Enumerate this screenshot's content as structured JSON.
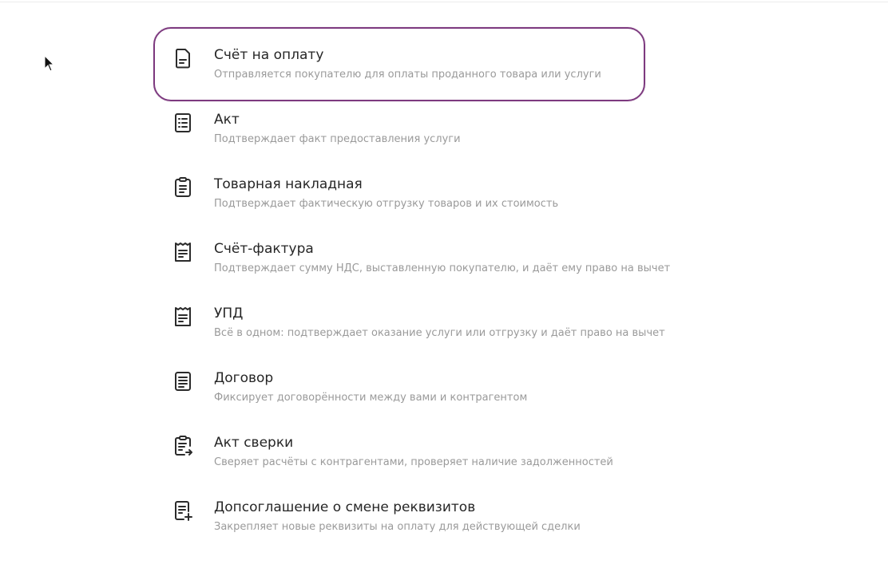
{
  "documents": [
    {
      "title": "Счёт на оплату",
      "description": "Отправляется покупателю для оплаты проданного товара или услуги",
      "icon": "invoice-icon",
      "selected": true
    },
    {
      "title": "Акт",
      "description": "Подтверждает факт предоставления услуги",
      "icon": "act-icon",
      "selected": false
    },
    {
      "title": "Товарная накладная",
      "description": "Подтверждает фактическую отгрузку товаров и их стоимость",
      "icon": "waybill-icon",
      "selected": false
    },
    {
      "title": "Счёт-фактура",
      "description": "Подтверждает сумму НДС, выставленную покупателю, и даёт ему право на вычет",
      "icon": "tax-invoice-icon",
      "selected": false
    },
    {
      "title": "УПД",
      "description": "Всё в одном: подтверждает оказание услуги или отгрузку и даёт право на вычет",
      "icon": "upd-icon",
      "selected": false
    },
    {
      "title": "Договор",
      "description": "Фиксирует договорённости между вами и контрагентом",
      "icon": "contract-icon",
      "selected": false
    },
    {
      "title": "Акт сверки",
      "description": "Сверяет расчёты с контрагентами, проверяет наличие задолженностей",
      "icon": "reconciliation-icon",
      "selected": false
    },
    {
      "title": "Допсоглашение о смене реквизитов",
      "description": "Закрепляет новые реквизиты на оплату для действующей сделки",
      "icon": "amendment-icon",
      "selected": false
    }
  ],
  "colors": {
    "accent": "#7d3a7f",
    "title": "#262626",
    "description": "#9a9a9a"
  }
}
